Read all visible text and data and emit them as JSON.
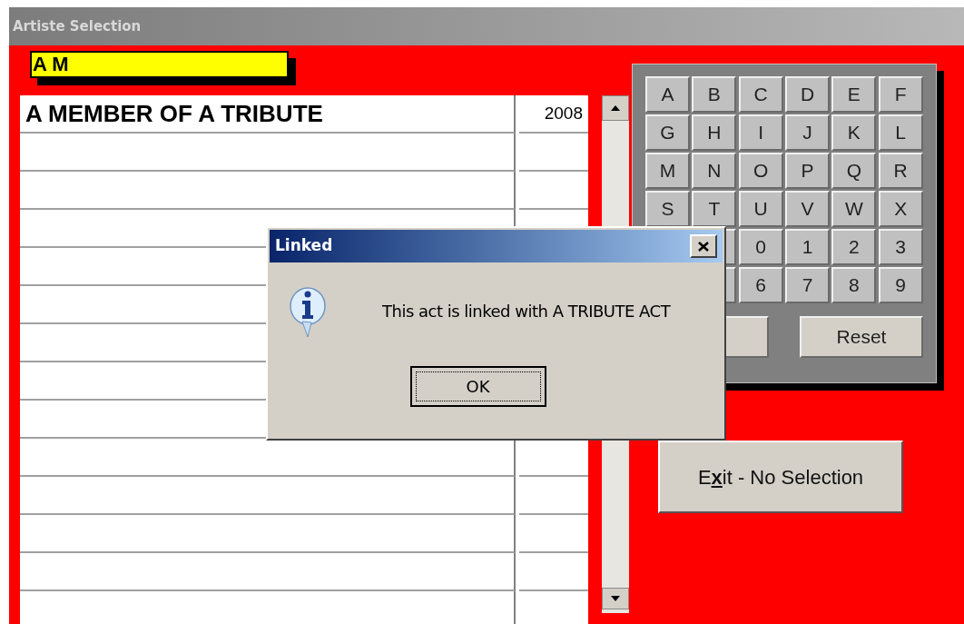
{
  "window": {
    "title": "Artiste Selection"
  },
  "search": {
    "value": "A M"
  },
  "table": {
    "rows": [
      {
        "name": "A MEMBER OF A TRIBUTE",
        "year": "2008"
      }
    ]
  },
  "keypad": {
    "keys": [
      {
        "kind": "key",
        "label": "A"
      },
      {
        "kind": "key",
        "label": "B"
      },
      {
        "kind": "key",
        "label": "C"
      },
      {
        "kind": "key",
        "label": "D"
      },
      {
        "kind": "key",
        "label": "E"
      },
      {
        "kind": "key",
        "label": "F"
      },
      {
        "kind": "key",
        "label": "G"
      },
      {
        "kind": "key",
        "label": "H"
      },
      {
        "kind": "key",
        "label": "I"
      },
      {
        "kind": "key",
        "label": "J"
      },
      {
        "kind": "key",
        "label": "K"
      },
      {
        "kind": "key",
        "label": "L"
      },
      {
        "kind": "key",
        "label": "M"
      },
      {
        "kind": "key",
        "label": "N"
      },
      {
        "kind": "key",
        "label": "O"
      },
      {
        "kind": "key",
        "label": "P"
      },
      {
        "kind": "key",
        "label": "Q"
      },
      {
        "kind": "key",
        "label": "R"
      },
      {
        "kind": "key",
        "label": "S"
      },
      {
        "kind": "key",
        "label": "T"
      },
      {
        "kind": "key",
        "label": "U"
      },
      {
        "kind": "key",
        "label": "V"
      },
      {
        "kind": "key",
        "label": "W"
      },
      {
        "kind": "key",
        "label": "X"
      },
      {
        "kind": "covered"
      },
      {
        "kind": "blank"
      },
      {
        "kind": "key",
        "label": "0"
      },
      {
        "kind": "key",
        "label": "1"
      },
      {
        "kind": "key",
        "label": "2"
      },
      {
        "kind": "key",
        "label": "3"
      },
      {
        "kind": "covered"
      },
      {
        "kind": "blank"
      },
      {
        "kind": "key",
        "label": "6"
      },
      {
        "kind": "key",
        "label": "7"
      },
      {
        "kind": "key",
        "label": "8"
      },
      {
        "kind": "key",
        "label": "9"
      }
    ],
    "bottom_buttons": [
      {
        "kind": "blank"
      },
      {
        "kind": "key",
        "label": "Reset"
      }
    ]
  },
  "exit_button": {
    "label_before": "E",
    "accesskey": "x",
    "label_after": "it - No Selection"
  },
  "dialog": {
    "title": "Linked",
    "message": "This act is linked with A TRIBUTE ACT",
    "button": "OK"
  }
}
